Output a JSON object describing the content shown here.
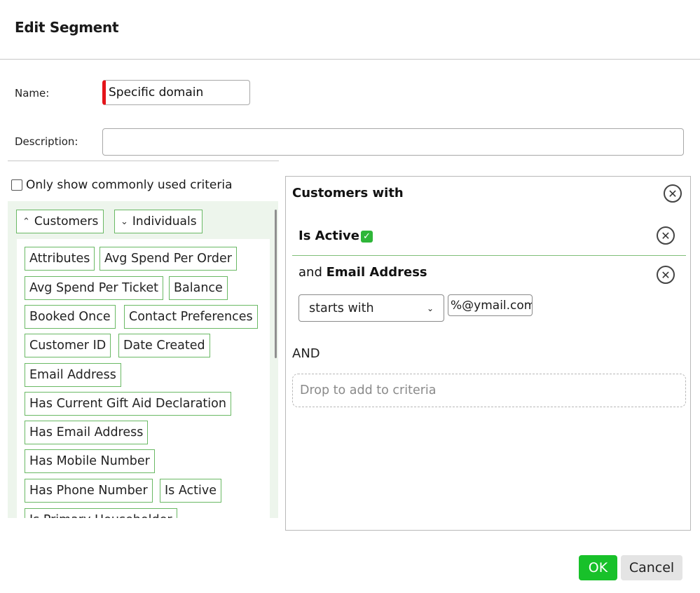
{
  "dialog": {
    "title": "Edit Segment"
  },
  "form": {
    "name_label": "Name:",
    "name_value": "Specific domain",
    "description_label": "Description:",
    "description_value": ""
  },
  "left": {
    "only_common_label": "Only show commonly used criteria",
    "only_common_checked": false,
    "tabs": [
      {
        "label": "Customers",
        "expanded": true
      },
      {
        "label": "Individuals",
        "expanded": false
      }
    ],
    "criteria": [
      "Attributes",
      "Avg Spend Per Order",
      "Avg Spend Per Ticket",
      "Balance",
      "Booked Once",
      "Contact Preferences",
      "Customer ID",
      "Date Created",
      "Email Address",
      "Has Current Gift Aid Declaration",
      "Has Email Address",
      "Has Mobile Number",
      "Has Phone Number",
      "Is Active",
      "Is Primary Householder"
    ]
  },
  "right": {
    "heading": "Customers with",
    "conditions": [
      {
        "prefix": "",
        "field": "Is Active",
        "checked": true
      },
      {
        "prefix": "and",
        "field": "Email Address",
        "operator": "starts with",
        "value": "%@ymail.com"
      }
    ],
    "and_label": "AND",
    "drop_placeholder": "Drop to add to criteria"
  },
  "buttons": {
    "ok": "OK",
    "cancel": "Cancel"
  },
  "colors": {
    "accent_green": "#18c12a",
    "criteria_border": "#6ab964",
    "required_marker": "#e4141a",
    "panel_bg": "#edf5ec"
  },
  "icons": {
    "remove": "circle-x-icon",
    "tab_expanded": "chevron-up-icon",
    "tab_collapsed": "chevron-down-icon",
    "checkmark": "check-icon",
    "select_caret": "chevron-down-icon"
  }
}
